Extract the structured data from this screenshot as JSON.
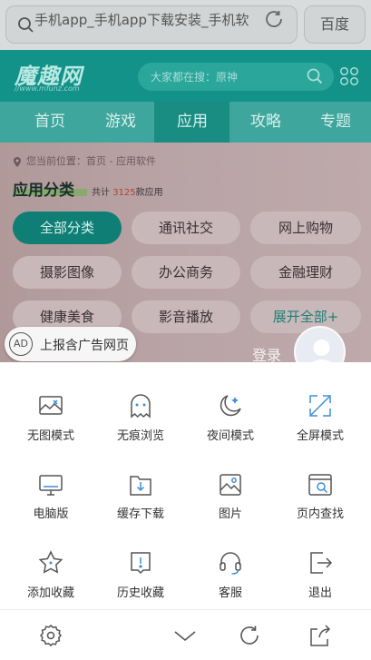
{
  "browser": {
    "url_text": "手机app_手机app下载安装_手机软",
    "engine_button": "百度"
  },
  "site": {
    "logo": "魔趣网",
    "logo_sub": "//www.mfunz.com",
    "search_placeholder": "大家都在搜：原神",
    "nav": [
      "首页",
      "游戏",
      "应用",
      "攻略",
      "专题"
    ],
    "nav_active_index": 2
  },
  "page": {
    "breadcrumb": "您当前位置：首页 - 应用软件",
    "category_title": "应用分类",
    "count_prefix": "共计",
    "count_number": "3125",
    "count_suffix": "款应用",
    "chips": [
      "全部分类",
      "通讯社交",
      "网上购物",
      "摄影图像",
      "办公商务",
      "金融理财",
      "健康美食",
      "影音播放",
      "展开全部+"
    ]
  },
  "ad_block": {
    "icon_text": "AD",
    "label": "上报含广告网页"
  },
  "login": {
    "label": "登录"
  },
  "menu": {
    "row1": [
      "无图模式",
      "无痕浏览",
      "夜间模式",
      "全屏模式"
    ],
    "row2": [
      "电脑版",
      "缓存下载",
      "图片",
      "页内查找"
    ],
    "row3": [
      "添加收藏",
      "历史收藏",
      "客服",
      "退出"
    ]
  },
  "colors": {
    "accent_teal": "#13928a",
    "icon_blue": "#3b8fd9",
    "icon_gray": "#555555"
  }
}
